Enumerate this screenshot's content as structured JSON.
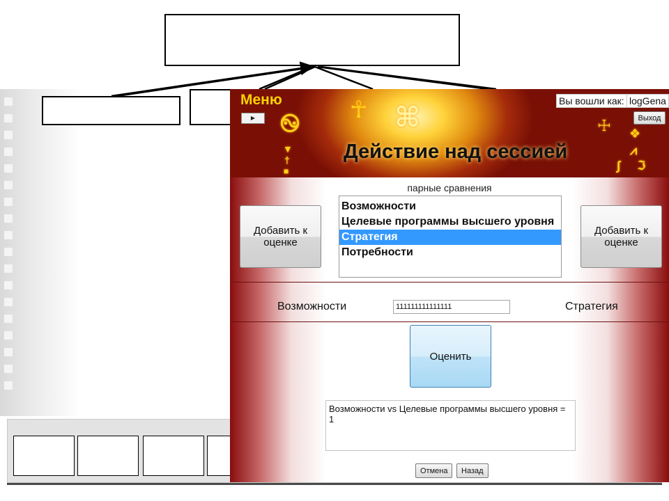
{
  "header": {
    "menu_label": "Меню",
    "menu_toggle_glyph": "▶",
    "login_label": "Вы вошли как:",
    "login_user": "logGena",
    "logout_label": "Выход",
    "title": "Действие над сессией"
  },
  "comparisons": {
    "title": "парные сравнения",
    "items": [
      {
        "label": "Возможности",
        "selected": false
      },
      {
        "label": "Целевые программы высшего уровня",
        "selected": false
      },
      {
        "label": "Стратегия",
        "selected": true
      },
      {
        "label": "Потребности",
        "selected": false
      }
    ],
    "add_left_label": "Добавить к оценке",
    "add_right_label": "Добавить к оценке"
  },
  "pair": {
    "left": "Возможности",
    "value": "111111111111111",
    "right": "Стратегия"
  },
  "evaluate_label": "Оценить",
  "result_text": "Возможности vs Целевые программы высшего уровня = 1",
  "footer": {
    "cancel_label": "Отмена",
    "back_label": "Назад"
  },
  "colors": {
    "header_dark": "#7a1005",
    "header_glow": "#ffd23a",
    "selection": "#3399ff",
    "evaluate_button": "#bfe3f8"
  },
  "icons": {
    "menu_toggle": "triangle-right-icon"
  }
}
